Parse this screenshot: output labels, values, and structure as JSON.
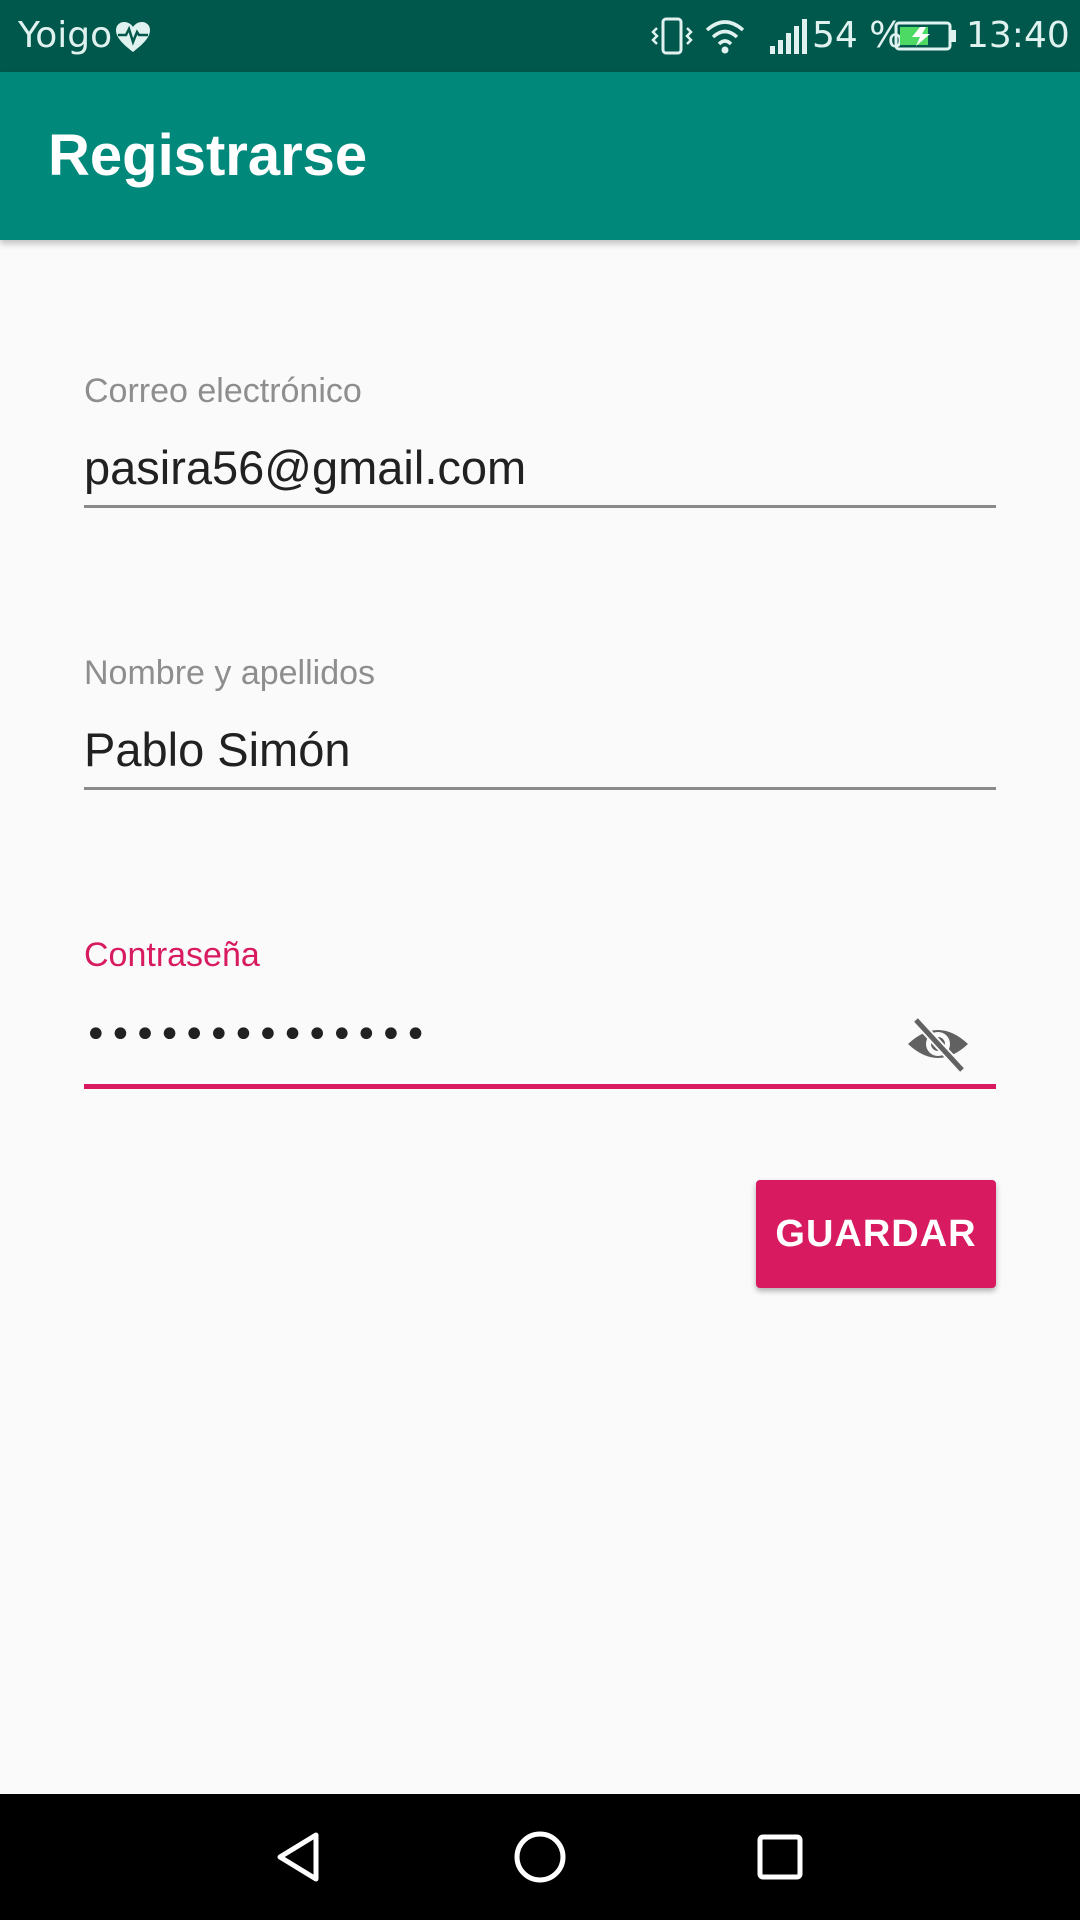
{
  "status_bar": {
    "carrier": "Yoigo",
    "battery_percent": "54 %",
    "time": "13:40",
    "icons": [
      "heart-monitor-icon",
      "vibrate-icon",
      "wifi-icon",
      "signal-icon",
      "battery-charging-icon"
    ]
  },
  "app_bar": {
    "title": "Registrarse"
  },
  "form": {
    "email": {
      "label": "Correo electrónico",
      "value": "pasira56@gmail.com"
    },
    "name": {
      "label": "Nombre y apellidos",
      "value": "Pablo Simón"
    },
    "password": {
      "label": "Contraseña",
      "masked_value": "••••••••••••••",
      "toggle_icon": "visibility-off-icon"
    },
    "save_label": "GUARDAR"
  },
  "navigation": {
    "buttons": [
      "back-icon",
      "home-icon",
      "recents-icon"
    ]
  },
  "colors": {
    "status_bar": "#00574b",
    "app_bar": "#00897b",
    "accent": "#d81b60",
    "background": "#fafafa"
  }
}
